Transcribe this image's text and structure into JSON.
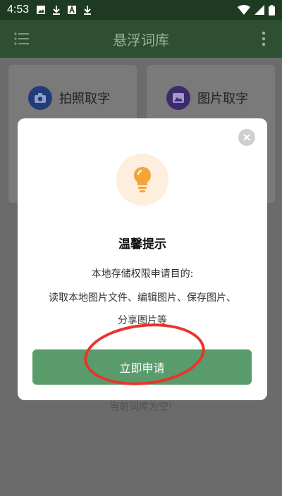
{
  "status_bar": {
    "time": "4:53",
    "left_icons": [
      "image-icon",
      "download-icon",
      "a-icon",
      "download-icon"
    ],
    "right_icons": [
      "wifi-icon",
      "signal-icon",
      "battery-icon"
    ]
  },
  "app_bar": {
    "title": "悬浮词库",
    "menu_icon": "menu-icon",
    "more_icon": "more-vert-icon"
  },
  "cards": [
    {
      "label": "拍照取字",
      "icon": "camera-icon",
      "color": "#223c7a"
    },
    {
      "label": "图片取字",
      "icon": "image-icon",
      "color": "#3d2a6d"
    }
  ],
  "empty_text": "当前词库为空!",
  "dialog": {
    "title": "温馨提示",
    "lines": [
      "本地存储权限申请目的:",
      "读取本地图片文件、编辑图片、保存图片、",
      "分享图片等"
    ],
    "button_label": "立即申请",
    "bulb_icon": "lightbulb-icon",
    "close_icon": "close-icon"
  },
  "colors": {
    "button": "#5a9b6b",
    "bulb": "#f5a43a",
    "highlight": "#e8342b"
  }
}
